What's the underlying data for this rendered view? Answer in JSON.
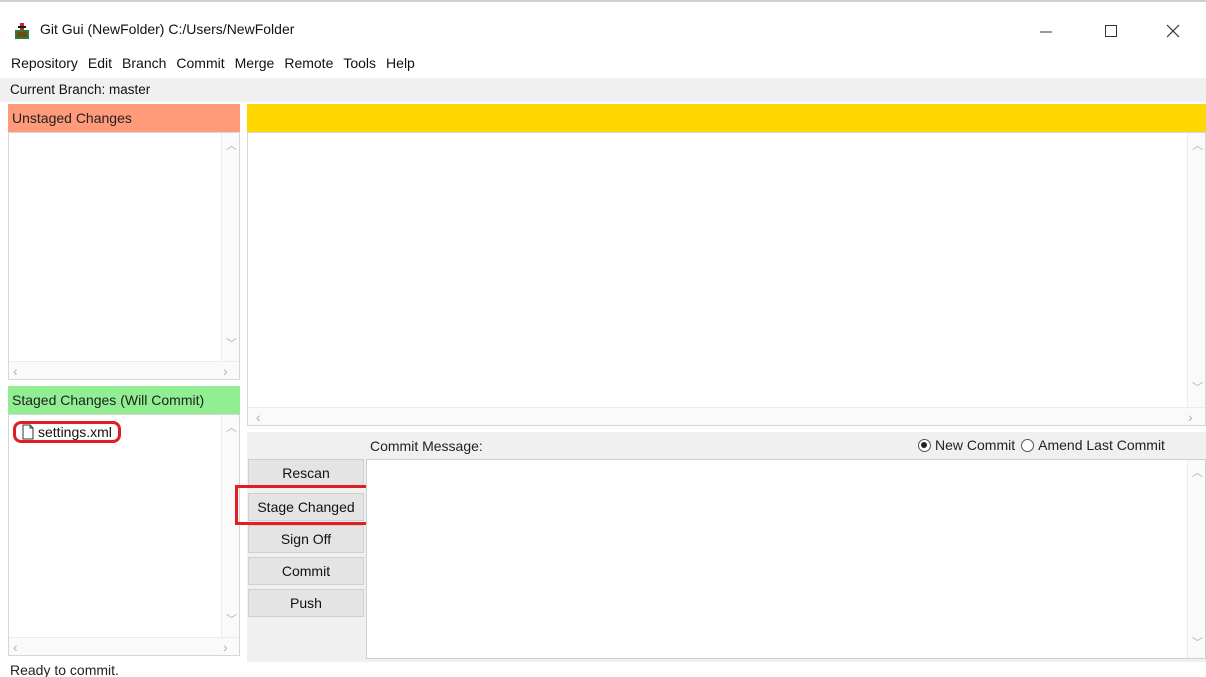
{
  "window": {
    "title": "Git Gui (NewFolder) C:/Users/NewFolder",
    "controls": {
      "minimize": "—",
      "maximize": "☐",
      "close": "✕"
    }
  },
  "menu": [
    "Repository",
    "Edit",
    "Branch",
    "Commit",
    "Merge",
    "Remote",
    "Tools",
    "Help"
  ],
  "current_branch": "Current Branch: master",
  "unstaged": {
    "header": "Unstaged Changes",
    "color": "#ff9a7a",
    "files": []
  },
  "staged": {
    "header": "Staged Changes (Will Commit)",
    "color": "#91ee91",
    "files": [
      "settings.xml"
    ]
  },
  "diff": {
    "header_color": "#ffd700"
  },
  "commit": {
    "label": "Commit Message:",
    "options": [
      "New Commit",
      "Amend Last Commit"
    ],
    "selected_option": "New Commit",
    "buttons": {
      "rescan": "Rescan",
      "stage_changed": "Stage Changed",
      "sign_off": "Sign Off",
      "commit": "Commit",
      "push": "Push"
    }
  },
  "status": "Ready to commit.",
  "highlight_color": "#e02020"
}
